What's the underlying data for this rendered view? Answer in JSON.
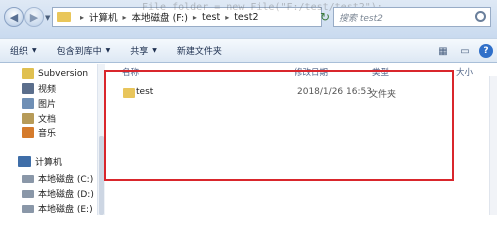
{
  "address": {
    "segments": [
      "计算机",
      "本地磁盘 (F:)",
      "test",
      "test2"
    ],
    "overlay_code": "File folder = new File(\"F:/test/test2\");"
  },
  "search": {
    "placeholder": "搜索 test2"
  },
  "toolbar": {
    "organize": "组织",
    "include_library": "包含到库中",
    "share": "共享",
    "new_folder": "新建文件夹"
  },
  "nav": {
    "items": [
      {
        "label": "Subversion",
        "icon": "subversion-folder-icon",
        "color": "#e0c050"
      },
      {
        "label": "视频",
        "icon": "video-library-icon",
        "color": "#5b6e8c"
      },
      {
        "label": "图片",
        "icon": "picture-library-icon",
        "color": "#6f8fb5"
      },
      {
        "label": "文档",
        "icon": "document-library-icon",
        "color": "#b79b58"
      },
      {
        "label": "音乐",
        "icon": "music-library-icon",
        "color": "#d57b2c"
      }
    ],
    "computer": "计算机",
    "drives": [
      "本地磁盘 (C:)",
      "本地磁盘 (D:)",
      "本地磁盘 (E:)"
    ]
  },
  "columns": {
    "name": "名称",
    "date": "修改日期",
    "type": "类型",
    "size": "大小"
  },
  "files": [
    {
      "name": "test",
      "date": "2018/1/26 16:53",
      "type": "文件夹"
    }
  ],
  "colors": {
    "highlight_box": "#d9262c",
    "folder": "#e8c55c"
  }
}
